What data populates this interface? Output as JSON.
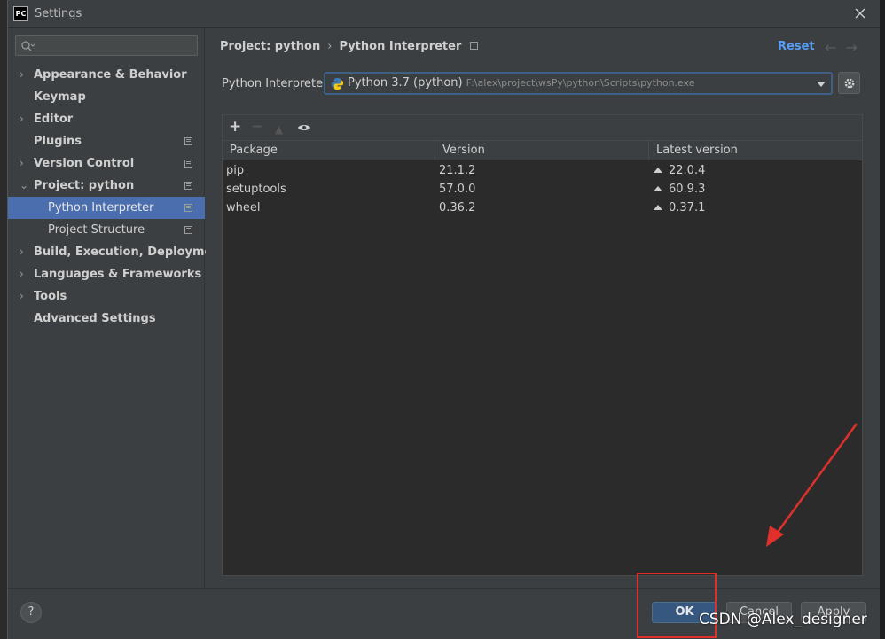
{
  "window": {
    "title": "Settings",
    "app_icon_text": "PC"
  },
  "sidebar": {
    "search_placeholder": "",
    "items": [
      {
        "label": "Appearance & Behavior",
        "chevron": "›"
      },
      {
        "label": "Keymap",
        "chevron": ""
      },
      {
        "label": "Editor",
        "chevron": "›"
      },
      {
        "label": "Plugins",
        "chevron": ""
      },
      {
        "label": "Version Control",
        "chevron": "›"
      },
      {
        "label": "Project: python",
        "chevron": "⌄"
      },
      {
        "label": "Python Interpreter",
        "chevron": ""
      },
      {
        "label": "Project Structure",
        "chevron": ""
      },
      {
        "label": "Build, Execution, Deployment",
        "chevron": "›"
      },
      {
        "label": "Languages & Frameworks",
        "chevron": "›"
      },
      {
        "label": "Tools",
        "chevron": "›"
      },
      {
        "label": "Advanced Settings",
        "chevron": ""
      }
    ]
  },
  "breadcrumb": {
    "project": "Project: python",
    "separator": "›",
    "page": "Python Interpreter"
  },
  "header": {
    "reset": "Reset"
  },
  "interpreter": {
    "label": "Python Interpreter:",
    "name": "Python 3.7 (python)",
    "path": "F:\\alex\\project\\wsPy\\python\\Scripts\\python.exe"
  },
  "packages": {
    "columns": [
      "Package",
      "Version",
      "Latest version"
    ],
    "rows": [
      {
        "package": "pip",
        "version": "21.1.2",
        "latest": "22.0.4"
      },
      {
        "package": "setuptools",
        "version": "57.0.0",
        "latest": "60.9.3"
      },
      {
        "package": "wheel",
        "version": "0.36.2",
        "latest": "0.37.1"
      }
    ]
  },
  "toolbar": {
    "add": "+",
    "remove": "−",
    "upgrade": "▲"
  },
  "footer": {
    "help": "?",
    "ok": "OK",
    "cancel": "Cancel",
    "apply": "Apply"
  },
  "watermark": "CSDN @Alex_designer",
  "colors": {
    "accent": "#4b6eaf",
    "link": "#589df6",
    "annotation": "#e0302c",
    "ok_button": "#365880"
  }
}
